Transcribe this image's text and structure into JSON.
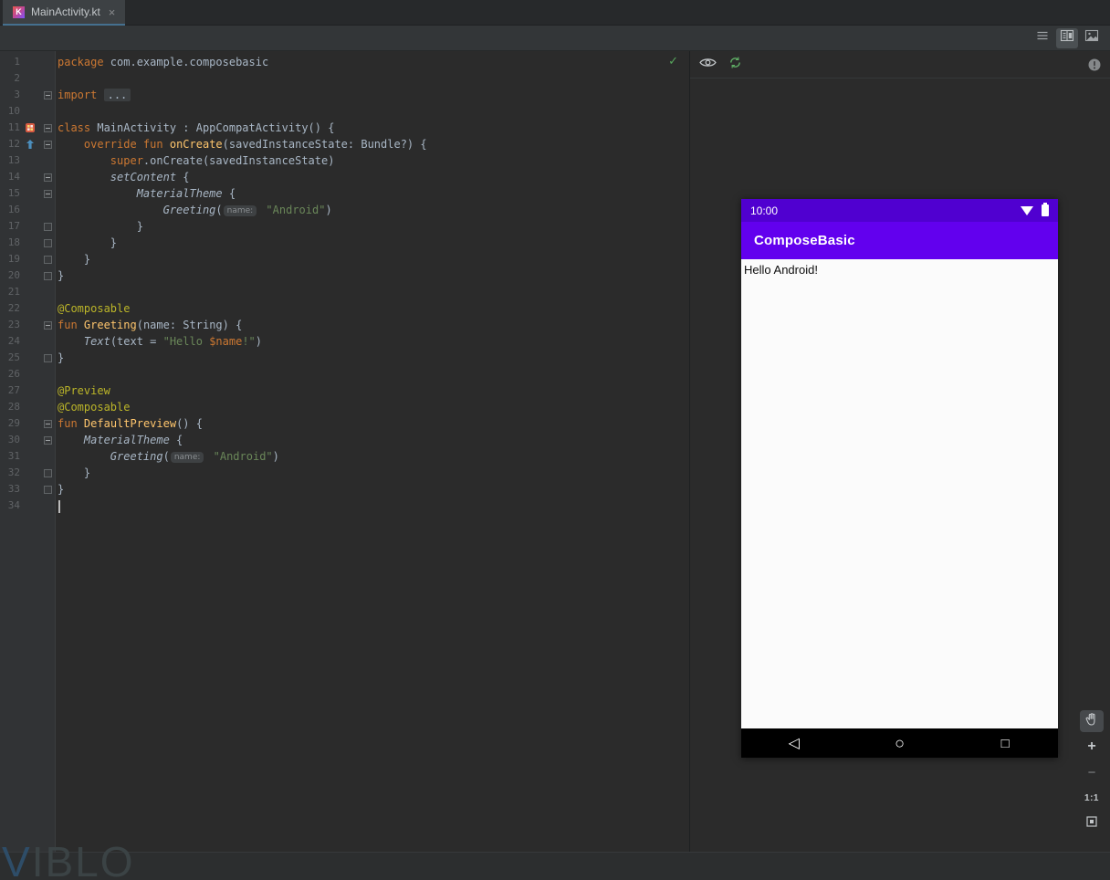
{
  "tab_bar": {
    "active_tab": {
      "title": "MainActivity.kt",
      "icon_letter": "K",
      "close_glyph": "×"
    }
  },
  "editor_toolbar": {
    "view_modes": [
      {
        "id": "code",
        "icon": "code-view-icon",
        "selected": false
      },
      {
        "id": "split",
        "icon": "split-view-icon",
        "selected": true
      },
      {
        "id": "design",
        "icon": "design-view-icon",
        "selected": false
      }
    ]
  },
  "editor": {
    "inspection_check": "✓",
    "lines": [
      {
        "num": "1",
        "segs": [
          {
            "t": "package",
            "c": "kw"
          },
          {
            "t": " com.example.composebasic",
            "c": "pl"
          }
        ]
      },
      {
        "num": "2",
        "segs": []
      },
      {
        "num": "3",
        "fold": "start",
        "segs": [
          {
            "t": "import",
            "c": "kw"
          },
          {
            "t": " ",
            "c": "pl"
          },
          {
            "t": "...",
            "c": "folded"
          }
        ]
      },
      {
        "num": "10",
        "segs": []
      },
      {
        "num": "11",
        "fold": "start",
        "icon": "run",
        "segs": [
          {
            "t": "class",
            "c": "kw"
          },
          {
            "t": " MainActivity : AppCompatActivity() {",
            "c": "pl"
          }
        ]
      },
      {
        "num": "12",
        "fold": "start",
        "icon": "override",
        "segs": [
          {
            "t": "    ",
            "c": "pl"
          },
          {
            "t": "override fun",
            "c": "kw"
          },
          {
            "t": " ",
            "c": "pl"
          },
          {
            "t": "onCreate",
            "c": "fn"
          },
          {
            "t": "(savedInstanceState: Bundle?) {",
            "c": "pl"
          }
        ]
      },
      {
        "num": "13",
        "segs": [
          {
            "t": "        ",
            "c": "pl"
          },
          {
            "t": "super",
            "c": "kw"
          },
          {
            "t": ".onCreate(savedInstanceState)",
            "c": "pl"
          }
        ]
      },
      {
        "num": "14",
        "fold": "start",
        "segs": [
          {
            "t": "        ",
            "c": "pl"
          },
          {
            "t": "setContent",
            "c": "it"
          },
          {
            "t": " {",
            "c": "pl"
          }
        ]
      },
      {
        "num": "15",
        "fold": "start",
        "segs": [
          {
            "t": "            ",
            "c": "pl"
          },
          {
            "t": "MaterialTheme",
            "c": "it"
          },
          {
            "t": " {",
            "c": "pl"
          }
        ]
      },
      {
        "num": "16",
        "segs": [
          {
            "t": "                ",
            "c": "pl"
          },
          {
            "t": "Greeting",
            "c": "it"
          },
          {
            "t": "(",
            "c": "pl"
          },
          {
            "t": "name:",
            "c": "hint"
          },
          {
            "t": " ",
            "c": "pl"
          },
          {
            "t": "\"Android\"",
            "c": "str"
          },
          {
            "t": ")",
            "c": "pl"
          }
        ]
      },
      {
        "num": "17",
        "fold": "end",
        "segs": [
          {
            "t": "            }",
            "c": "pl"
          }
        ]
      },
      {
        "num": "18",
        "fold": "end",
        "segs": [
          {
            "t": "        }",
            "c": "pl"
          }
        ]
      },
      {
        "num": "19",
        "fold": "end",
        "segs": [
          {
            "t": "    }",
            "c": "pl"
          }
        ]
      },
      {
        "num": "20",
        "fold": "end",
        "segs": [
          {
            "t": "}",
            "c": "pl"
          }
        ]
      },
      {
        "num": "21",
        "segs": []
      },
      {
        "num": "22",
        "segs": [
          {
            "t": "@Composable",
            "c": "ann"
          }
        ]
      },
      {
        "num": "23",
        "fold": "start",
        "segs": [
          {
            "t": "fun",
            "c": "kw"
          },
          {
            "t": " ",
            "c": "pl"
          },
          {
            "t": "Greeting",
            "c": "fn"
          },
          {
            "t": "(name: String) {",
            "c": "pl"
          }
        ]
      },
      {
        "num": "24",
        "segs": [
          {
            "t": "    ",
            "c": "pl"
          },
          {
            "t": "Text",
            "c": "it"
          },
          {
            "t": "(text = ",
            "c": "pl"
          },
          {
            "t": "\"Hello ",
            "c": "str"
          },
          {
            "t": "$name",
            "c": "tmpl"
          },
          {
            "t": "!\"",
            "c": "str"
          },
          {
            "t": ")",
            "c": "pl"
          }
        ]
      },
      {
        "num": "25",
        "fold": "end",
        "segs": [
          {
            "t": "}",
            "c": "pl"
          }
        ]
      },
      {
        "num": "26",
        "segs": []
      },
      {
        "num": "27",
        "segs": [
          {
            "t": "@Preview",
            "c": "ann"
          }
        ]
      },
      {
        "num": "28",
        "segs": [
          {
            "t": "@Composable",
            "c": "ann"
          }
        ]
      },
      {
        "num": "29",
        "fold": "start",
        "segs": [
          {
            "t": "fun",
            "c": "kw"
          },
          {
            "t": " ",
            "c": "pl"
          },
          {
            "t": "DefaultPreview",
            "c": "fn"
          },
          {
            "t": "() {",
            "c": "pl"
          }
        ]
      },
      {
        "num": "30",
        "fold": "start",
        "segs": [
          {
            "t": "    ",
            "c": "pl"
          },
          {
            "t": "MaterialTheme",
            "c": "it"
          },
          {
            "t": " {",
            "c": "pl"
          }
        ]
      },
      {
        "num": "31",
        "segs": [
          {
            "t": "        ",
            "c": "pl"
          },
          {
            "t": "Greeting",
            "c": "it"
          },
          {
            "t": "(",
            "c": "pl"
          },
          {
            "t": "name:",
            "c": "hint"
          },
          {
            "t": " ",
            "c": "pl"
          },
          {
            "t": "\"Android\"",
            "c": "str"
          },
          {
            "t": ")",
            "c": "pl"
          }
        ]
      },
      {
        "num": "32",
        "fold": "end",
        "segs": [
          {
            "t": "    }",
            "c": "pl"
          }
        ]
      },
      {
        "num": "33",
        "fold": "end",
        "segs": [
          {
            "t": "}",
            "c": "pl"
          }
        ]
      },
      {
        "num": "34",
        "caret": true,
        "segs": []
      }
    ]
  },
  "preview_panel": {
    "toolbar": {
      "left_icons": [
        "eye-icon",
        "refresh-icon"
      ],
      "right_icon": "issues-icon"
    },
    "device": {
      "status_bar": {
        "time": "10:00"
      },
      "app_bar": {
        "title": "ComposeBasic"
      },
      "content_text": "Hello Android!",
      "nav": {
        "back": "◁",
        "home": "○",
        "recents": "□"
      }
    },
    "zoom_controls": {
      "zoom_in": "+",
      "zoom_out": "−",
      "ratio": "1:1"
    }
  },
  "colors": {
    "app_bar_purple": "#6200ee",
    "status_bar_purple": "#5000d0",
    "keyword_orange": "#cc7832",
    "function_yellow": "#ffc66d",
    "annotation_yellow": "#bbb529",
    "string_green": "#6a8759",
    "editor_bg": "#2b2b2b"
  },
  "watermark": {
    "first_letter": "V",
    "rest": "IBLO"
  }
}
